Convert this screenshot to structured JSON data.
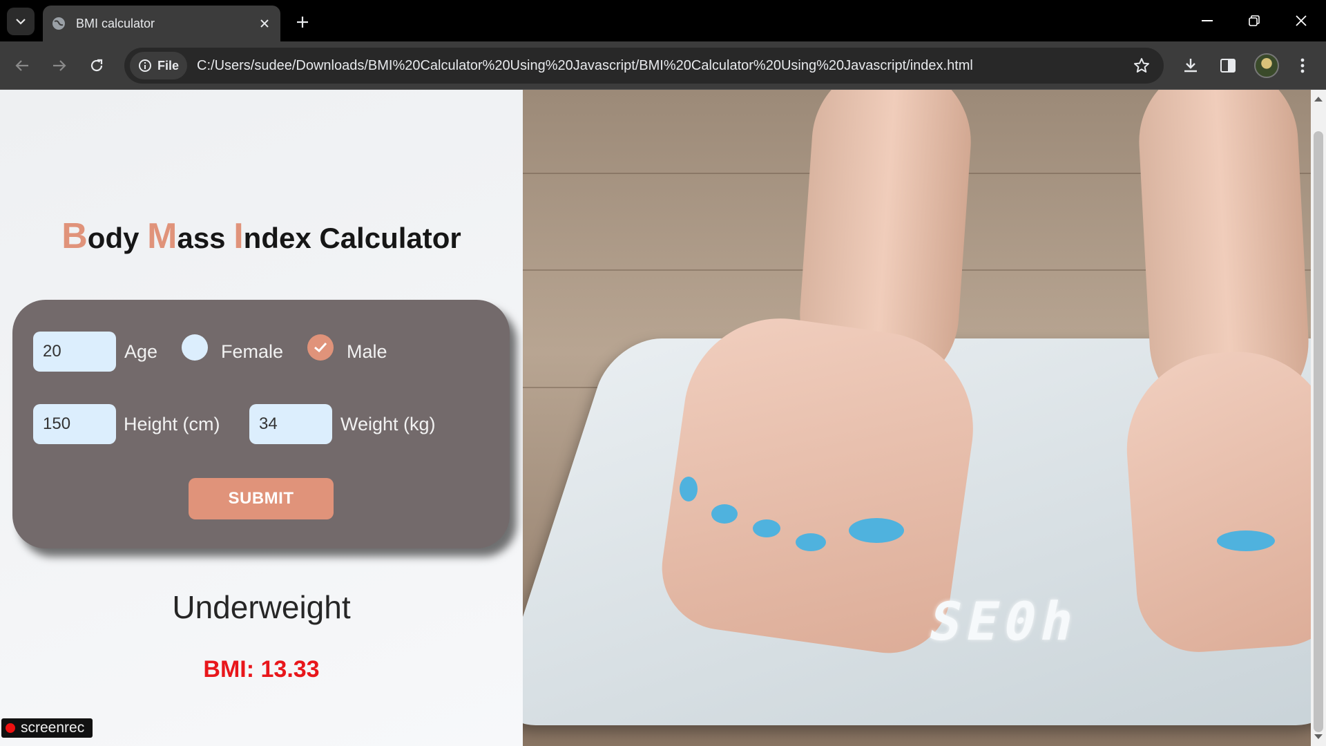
{
  "browser": {
    "tab_title": "BMI calculator",
    "site_chip": "File",
    "url": "C:/Users/sudee/Downloads/BMI%20Calculator%20Using%20Javascript/BMI%20Calculator%20Using%20Javascript/index.html"
  },
  "heading": {
    "b": "B",
    "ody": "ody ",
    "m": "M",
    "ass": "ass ",
    "i": "I",
    "ndex": "ndex Calculator"
  },
  "form": {
    "age_value": "20",
    "age_label": "Age",
    "female_label": "Female",
    "male_label": "Male",
    "selected_gender": "Male",
    "height_value": "150",
    "height_label": "Height (cm)",
    "weight_value": "34",
    "weight_label": "Weight (kg)",
    "submit_label": "SUBMIT"
  },
  "result": {
    "category": "Underweight",
    "bmi_text": "BMI: 13.33"
  },
  "overlay": {
    "recorder_label": "screenrec"
  },
  "photo": {
    "scale_display": "SE0h"
  },
  "colors": {
    "accent": "#e0937a",
    "card": "#736a6b",
    "input_bg": "#dceefd",
    "bmi_red": "#e8161b"
  }
}
